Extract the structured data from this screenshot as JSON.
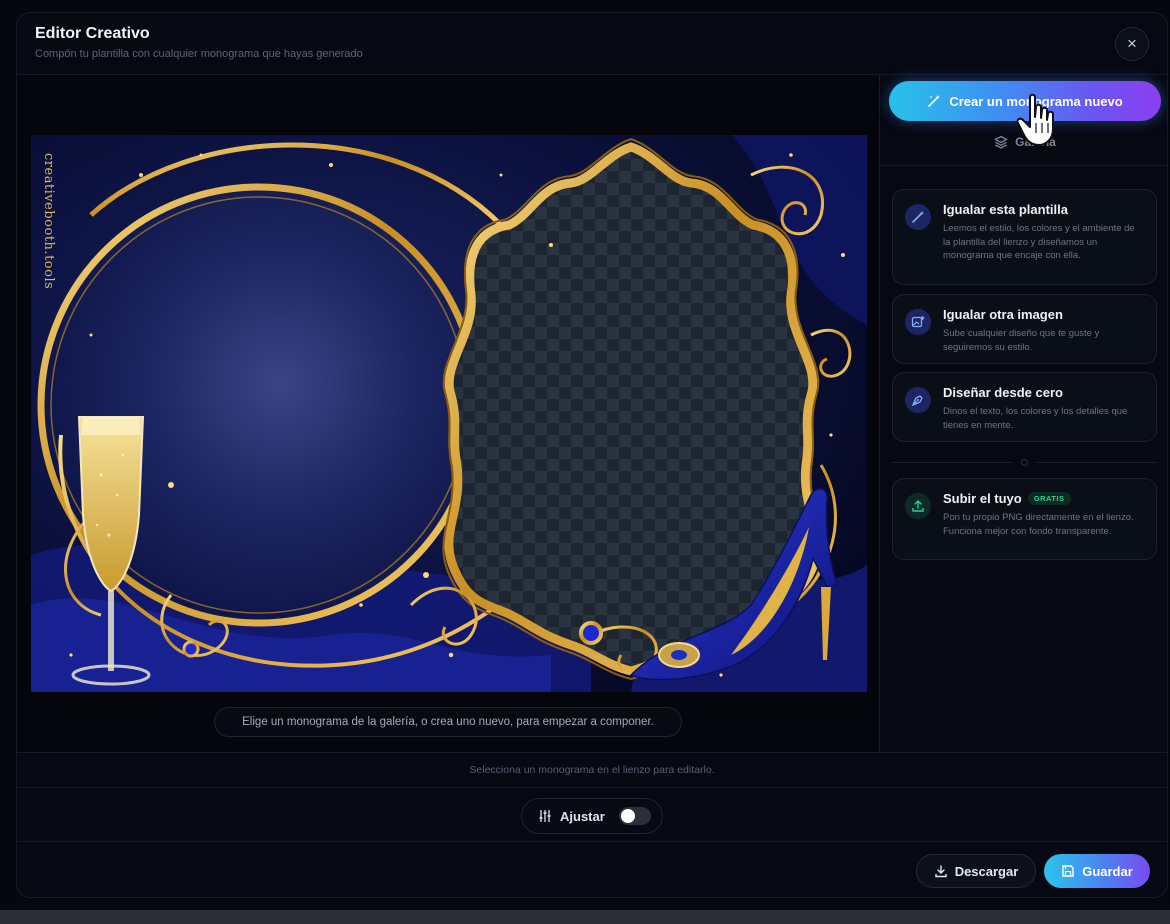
{
  "header": {
    "title": "Editor Creativo",
    "subtitle": "Compón tu plantilla con cualquier monograma que hayas generado",
    "close_label": "×"
  },
  "canvas": {
    "watermark": "creativebooth.tools",
    "hint": "Elige un monograma de la galería, o crea uno nuevo, para empezar a componer."
  },
  "sidebar": {
    "create_button": "Crear un monograma nuevo",
    "gallery_tab": "Galería",
    "options": [
      {
        "title": "Igualar esta plantilla",
        "description": "Leemos el estilo, los colores y el ambiente de la plantilla del lienzo y diseñamos un monograma que encaje con ella.",
        "icon": "magic-wand-icon"
      },
      {
        "title": "Igualar otra imagen",
        "description": "Sube cualquier diseño que te guste y seguiremos su estilo.",
        "icon": "image-plus-icon"
      },
      {
        "title": "Diseñar desde cero",
        "description": "Dinos el texto, los colores y los detalles que tienes en mente.",
        "icon": "pen-tool-icon"
      }
    ],
    "upload": {
      "title": "Subir el tuyo",
      "badge": "GRATIS",
      "description": "Pon tu propio PNG directamente en el lienzo. Funciona mejor con fondo transparente.",
      "icon": "upload-icon"
    }
  },
  "status_bar": {
    "text": "Selecciona un monograma en el lienzo para editarlo."
  },
  "adjust": {
    "label": "Ajustar",
    "toggle_on": false
  },
  "footer": {
    "download_label": "Descargar",
    "save_label": "Guardar"
  },
  "colors": {
    "accent_start": "#27c2e8",
    "accent_end": "#8b3ff0",
    "gold": "#d9a93a",
    "navy": "#1a2a8a",
    "badge_green": "#27d29a"
  }
}
